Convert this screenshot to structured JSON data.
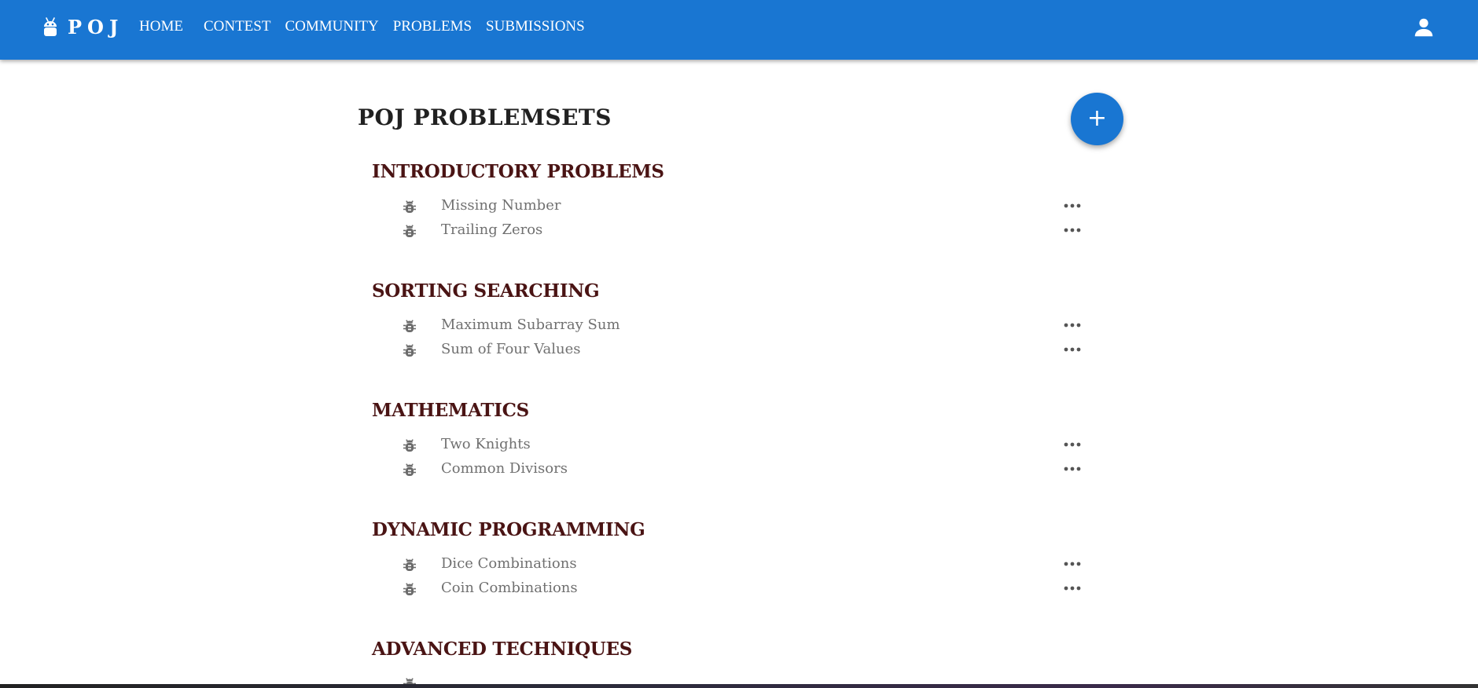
{
  "app": {
    "brand": "POJ",
    "colors": {
      "primary": "#1976d2",
      "section_title": "#4a1414",
      "problem_text": "#707070"
    }
  },
  "nav": {
    "items": [
      {
        "label": "HOME"
      },
      {
        "label": "CONTEST"
      },
      {
        "label": "COMMUNITY"
      },
      {
        "label": "PROBLEMS"
      },
      {
        "label": "SUBMISSIONS"
      }
    ],
    "user_icon": "account-icon"
  },
  "page": {
    "title": "POJ PROBLEMSETS",
    "fab_label": "+",
    "sections": [
      {
        "title": "INTRODUCTORY PROBLEMS",
        "problems": [
          {
            "name": "Missing Number"
          },
          {
            "name": "Trailing Zeros"
          }
        ]
      },
      {
        "title": "SORTING SEARCHING",
        "problems": [
          {
            "name": "Maximum Subarray Sum"
          },
          {
            "name": "Sum of Four Values"
          }
        ]
      },
      {
        "title": "MATHEMATICS",
        "problems": [
          {
            "name": "Two Knights"
          },
          {
            "name": "Common Divisors"
          }
        ]
      },
      {
        "title": "DYNAMIC PROGRAMMING",
        "problems": [
          {
            "name": "Dice Combinations"
          },
          {
            "name": "Coin Combinations"
          }
        ]
      },
      {
        "title": "ADVANCED TECHNIQUES",
        "problems": []
      }
    ],
    "problem_icon": "bug-icon",
    "more_icon": "more-horizontal-icon"
  }
}
